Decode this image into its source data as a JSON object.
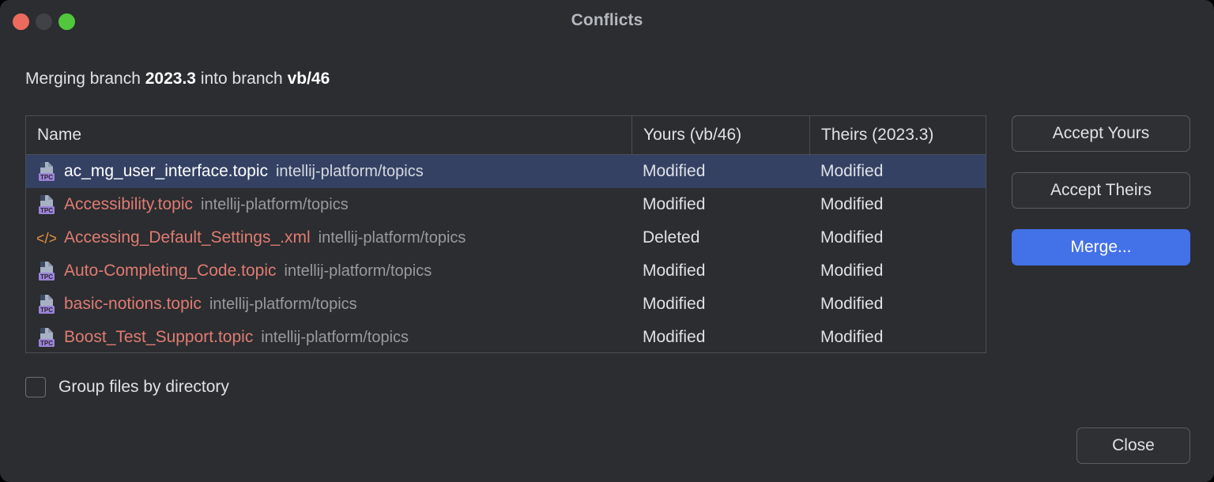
{
  "window": {
    "title": "Conflicts",
    "traffic_lights": [
      {
        "name": "close",
        "color": "#ec6a5e"
      },
      {
        "name": "minimize",
        "color": "#3f4246"
      },
      {
        "name": "zoom",
        "color": "#51c73b"
      }
    ]
  },
  "description": {
    "prefix": "Merging branch ",
    "source_branch": "2023.3",
    "middle": " into branch ",
    "target_branch": "vb/46"
  },
  "table": {
    "columns": [
      "Name",
      "Yours (vb/46)",
      "Theirs (2023.3)"
    ],
    "rows": [
      {
        "icon": "topic-file-icon",
        "name": "ac_mg_user_interface.topic",
        "path": "intellij-platform/topics",
        "yours": "Modified",
        "theirs": "Modified",
        "selected": true
      },
      {
        "icon": "topic-file-icon",
        "name": "Accessibility.topic",
        "path": "intellij-platform/topics",
        "yours": "Modified",
        "theirs": "Modified",
        "selected": false
      },
      {
        "icon": "xml-file-icon",
        "name": "Accessing_Default_Settings_.xml",
        "path": "intellij-platform/topics",
        "yours": "Deleted",
        "theirs": "Modified",
        "selected": false
      },
      {
        "icon": "topic-file-icon",
        "name": "Auto-Completing_Code.topic",
        "path": "intellij-platform/topics",
        "yours": "Modified",
        "theirs": "Modified",
        "selected": false
      },
      {
        "icon": "topic-file-icon",
        "name": "basic-notions.topic",
        "path": "intellij-platform/topics",
        "yours": "Modified",
        "theirs": "Modified",
        "selected": false
      },
      {
        "icon": "topic-file-icon",
        "name": "Boost_Test_Support.topic",
        "path": "intellij-platform/topics",
        "yours": "Modified",
        "theirs": "Modified",
        "selected": false
      }
    ]
  },
  "buttons": {
    "accept_yours": "Accept Yours",
    "accept_theirs": "Accept Theirs",
    "merge": "Merge...",
    "close": "Close"
  },
  "options": {
    "group_by_directory_label": "Group files by directory",
    "group_by_directory_checked": false
  },
  "colors": {
    "background": "#2b2d30",
    "selection": "#344163",
    "primary_button": "#4371e8",
    "filename": "#e07b72",
    "path": "#989a9e",
    "icon_badge": "#9b84d8",
    "xml_icon": "#e8913c"
  }
}
